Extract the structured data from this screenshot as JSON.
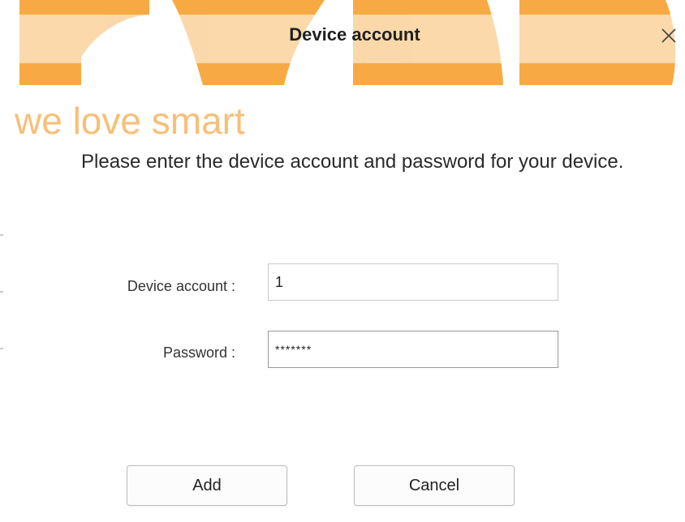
{
  "watermark": {
    "tagline": "we love smart",
    "color": "#f7a53a"
  },
  "dialog": {
    "title": "Device account",
    "close_icon": "close-icon",
    "instructions": "Please enter the device account and password for your device.",
    "fields": {
      "account": {
        "label": "Device account :",
        "value": "1"
      },
      "password": {
        "label": "Password :",
        "value": "*******"
      }
    },
    "buttons": {
      "add": "Add",
      "cancel": "Cancel"
    }
  }
}
